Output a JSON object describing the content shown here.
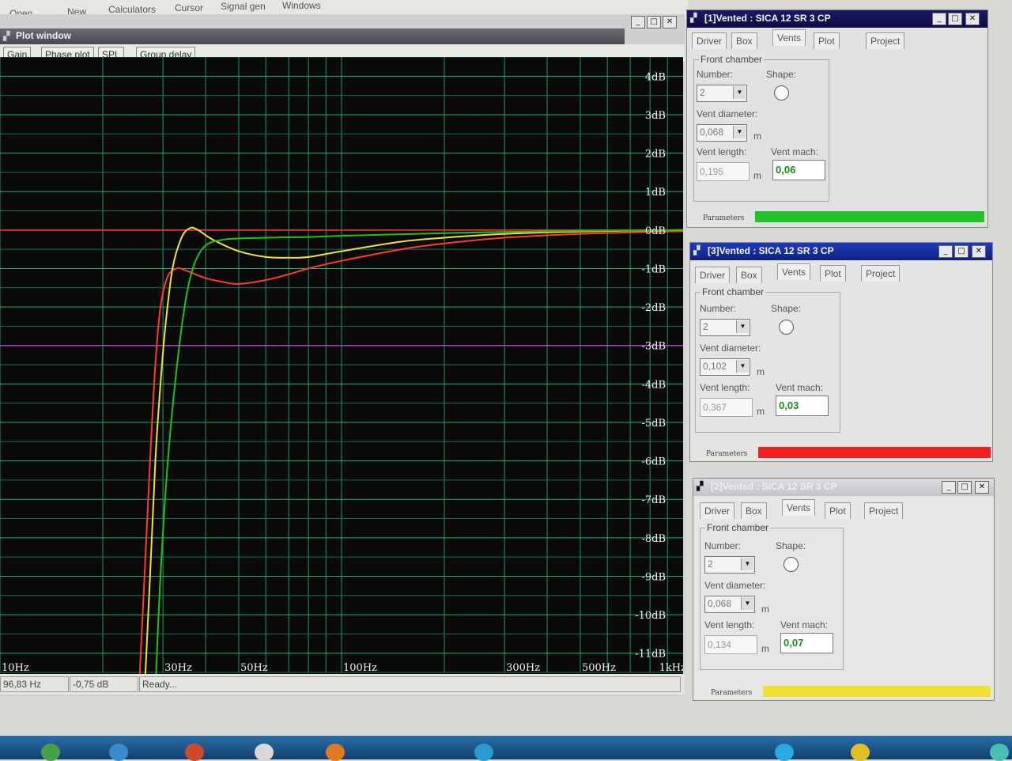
{
  "menu": [
    "Open",
    "New",
    "Calculators",
    "Cursor",
    "Signal gen",
    "Windows"
  ],
  "plot_window": {
    "title": "Plot window",
    "tabs": [
      "Gain",
      "Phase plot",
      "SPL",
      "Group delay"
    ],
    "status": {
      "freq": "96,83 Hz",
      "level": "-0,75 dB",
      "message": "Ready..."
    }
  },
  "chart_data": {
    "type": "line",
    "x_scale": "log",
    "xlim": [
      10,
      1000
    ],
    "ylim": [
      -11.5,
      4.5
    ],
    "x_ticks": [
      {
        "v": 10,
        "label": "10Hz"
      },
      {
        "v": 30,
        "label": "30Hz"
      },
      {
        "v": 50,
        "label": "50Hz"
      },
      {
        "v": 100,
        "label": "100Hz"
      },
      {
        "v": 300,
        "label": "300Hz"
      },
      {
        "v": 500,
        "label": "500Hz"
      },
      {
        "v": 1000,
        "label": "1kHz"
      }
    ],
    "y_ticks": [
      {
        "v": 4,
        "label": "4dB"
      },
      {
        "v": 3,
        "label": "3dB"
      },
      {
        "v": 2,
        "label": "2dB"
      },
      {
        "v": 1,
        "label": "1dB"
      },
      {
        "v": 0,
        "label": "0dB"
      },
      {
        "v": -1,
        "label": "-1dB"
      },
      {
        "v": -2,
        "label": "-2dB"
      },
      {
        "v": -3,
        "label": "-3dB"
      },
      {
        "v": -4,
        "label": "-4dB"
      },
      {
        "v": -5,
        "label": "-5dB"
      },
      {
        "v": -6,
        "label": "-6dB"
      },
      {
        "v": -7,
        "label": "-7dB"
      },
      {
        "v": -8,
        "label": "-8dB"
      },
      {
        "v": -9,
        "label": "-9dB"
      },
      {
        "v": -10,
        "label": "-10dB"
      },
      {
        "v": -11,
        "label": "-11dB"
      }
    ],
    "reference_lines": [
      {
        "y": 0,
        "color": "#ff3b2f"
      },
      {
        "y": -3,
        "color": "#b040c0"
      }
    ],
    "series": [
      {
        "color": "#ff3b2f",
        "points": [
          [
            25.5,
            -12
          ],
          [
            26.5,
            -9
          ],
          [
            27.5,
            -6
          ],
          [
            28.5,
            -3.5
          ],
          [
            29.5,
            -2
          ],
          [
            31,
            -1.2
          ],
          [
            33,
            -1
          ],
          [
            35,
            -1.05
          ],
          [
            40,
            -1.25
          ],
          [
            45,
            -1.35
          ],
          [
            50,
            -1.4
          ],
          [
            60,
            -1.3
          ],
          [
            70,
            -1.15
          ],
          [
            80,
            -1
          ],
          [
            100,
            -0.8
          ],
          [
            150,
            -0.5
          ],
          [
            200,
            -0.35
          ],
          [
            300,
            -0.2
          ],
          [
            500,
            -0.1
          ],
          [
            1000,
            -0.03
          ]
        ]
      },
      {
        "color": "#f0e040",
        "points": [
          [
            26.5,
            -12
          ],
          [
            27.5,
            -9
          ],
          [
            28.5,
            -6
          ],
          [
            29.5,
            -4
          ],
          [
            30.5,
            -2.5
          ],
          [
            32,
            -1
          ],
          [
            34,
            -0.2
          ],
          [
            36,
            0.05
          ],
          [
            38,
            0
          ],
          [
            42,
            -0.25
          ],
          [
            50,
            -0.55
          ],
          [
            60,
            -0.7
          ],
          [
            70,
            -0.72
          ],
          [
            80,
            -0.7
          ],
          [
            100,
            -0.55
          ],
          [
            150,
            -0.3
          ],
          [
            200,
            -0.2
          ],
          [
            300,
            -0.1
          ],
          [
            500,
            -0.04
          ],
          [
            1000,
            0
          ]
        ]
      },
      {
        "color": "#20c020",
        "points": [
          [
            28.5,
            -12
          ],
          [
            29.5,
            -9
          ],
          [
            31,
            -6
          ],
          [
            33,
            -3.5
          ],
          [
            35,
            -1.8
          ],
          [
            37,
            -0.9
          ],
          [
            40,
            -0.4
          ],
          [
            45,
            -0.25
          ],
          [
            50,
            -0.22
          ],
          [
            60,
            -0.2
          ],
          [
            80,
            -0.18
          ],
          [
            100,
            -0.15
          ],
          [
            200,
            -0.08
          ],
          [
            300,
            -0.05
          ],
          [
            500,
            -0.02
          ],
          [
            1000,
            0
          ]
        ]
      }
    ]
  },
  "panels": [
    {
      "title": "[1]Vented : SICA 12 SR 3 CP",
      "tabs": [
        "Driver",
        "Box",
        "Vents",
        "Plot",
        "Project"
      ],
      "group_title": "Front chamber",
      "labels": {
        "number": "Number:",
        "shape": "Shape:",
        "diameter": "Vent diameter:",
        "length": "Vent length:",
        "mach": "Vent mach:"
      },
      "number": "2",
      "diameter": "0,068",
      "unit": "m",
      "length": "0,195",
      "mach": "0,06",
      "params": "Parameters",
      "bar_color": "#22c22a",
      "title_color": "#0f0f55"
    },
    {
      "title": "[3]Vented : SICA 12 SR 3 CP",
      "tabs": [
        "Driver",
        "Box",
        "Vents",
        "Plot",
        "Project"
      ],
      "group_title": "Front chamber",
      "labels": {
        "number": "Number:",
        "shape": "Shape:",
        "diameter": "Vent diameter:",
        "length": "Vent length:",
        "mach": "Vent mach:"
      },
      "number": "2",
      "diameter": "0,102",
      "unit": "m",
      "length": "0,367",
      "mach": "0,03",
      "params": "Parameters",
      "bar_color": "#f02020",
      "title_color": "#1530a8"
    },
    {
      "title": "[2]Vented : SICA 12 SR 3 CP",
      "tabs": [
        "Driver",
        "Box",
        "Vents",
        "Plot",
        "Project"
      ],
      "group_title": "Front chamber",
      "labels": {
        "number": "Number:",
        "shape": "Shape:",
        "diameter": "Vent diameter:",
        "length": "Vent length:",
        "mach": "Vent mach:"
      },
      "number": "2",
      "diameter": "0,068",
      "unit": "m",
      "length": "0,134",
      "mach": "0,07",
      "params": "Parameters",
      "bar_color": "#f0e030",
      "title_color": "#c8c8cc"
    }
  ]
}
